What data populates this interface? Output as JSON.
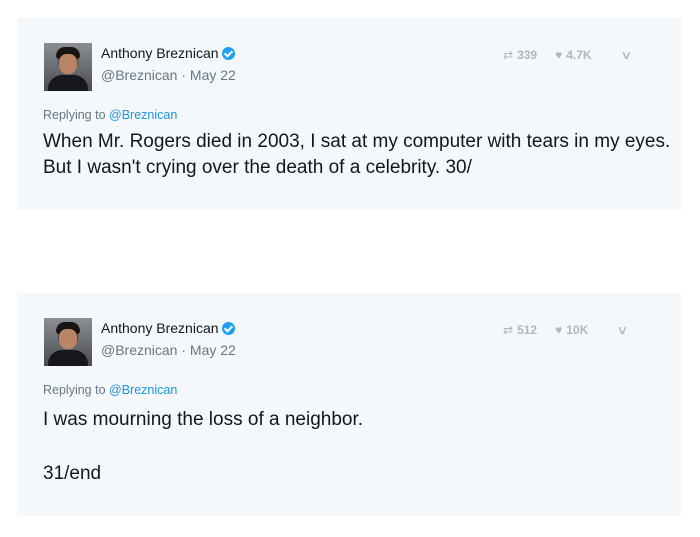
{
  "tweets": [
    {
      "author_name": "Anthony Breznican",
      "handle": "@Breznican",
      "date": "May 22",
      "retweets": "339",
      "likes": "4.7K",
      "replying_prefix": "Replying to",
      "replying_to": "@Breznican",
      "text": "When Mr. Rogers died in 2003, I sat at my computer with tears in my eyes. But I wasn't crying over the death of a celebrity. 30/"
    },
    {
      "author_name": "Anthony Breznican",
      "handle": "@Breznican",
      "date": "May 22",
      "retweets": "512",
      "likes": "10K",
      "replying_prefix": "Replying to",
      "replying_to": "@Breznican",
      "text": "I was mourning the loss of a neighbor.\n\n31/end"
    }
  ],
  "icons": {
    "retweet": "retweet-icon",
    "like": "heart-icon",
    "menu": "chevron-down-icon",
    "verified": "verified-badge-icon"
  },
  "colors": {
    "card_bg": "#f5f8fa",
    "link": "#1b95e0",
    "verified": "#1da1f2",
    "muted": "#657786",
    "action_muted": "#aab8c2"
  }
}
